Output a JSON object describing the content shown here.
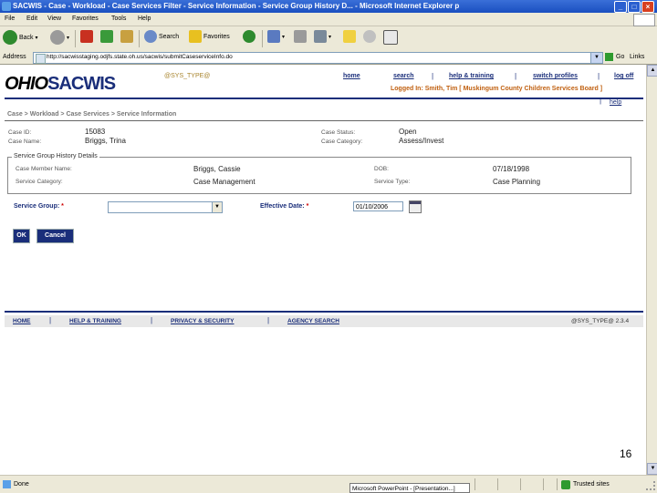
{
  "window": {
    "title": "SACWIS - Case - Workload - Case Services Filter - Service Information - Service Group History D... - Microsoft Internet Explorer p",
    "min": "_",
    "max": "□",
    "close": "×"
  },
  "menu": [
    "File",
    "Edit",
    "View",
    "Favorites",
    "Tools",
    "Help"
  ],
  "toolbar": {
    "back": "Back",
    "search": "Search",
    "favorites": "Favorites"
  },
  "address": {
    "label": "Address",
    "url": "http://sacwisstaging.odjfs.state.oh.us/sacwis/submitCaseserviceInfo.do",
    "go": "Go",
    "links": "Links"
  },
  "header": {
    "logo_ohio": "OHIO",
    "logo_sacwis": "SACWIS",
    "systype": "@SYS_TYPE@",
    "nav": [
      "home",
      "search",
      "help & training",
      "switch profiles",
      "log off"
    ],
    "logged_in": "Logged In: Smith, Tim [ Muskingum County Children Services Board ]",
    "help": "help"
  },
  "breadcrumb": "Case > Workload > Case Services > Service Information",
  "case": {
    "id_label": "Case ID:",
    "id": "15083",
    "name_label": "Case Name:",
    "name": "Briggs, Trina",
    "status_label": "Case Status:",
    "status": "Open",
    "category_label": "Case Category:",
    "category": "Assess/Invest"
  },
  "history": {
    "legend": "Service Group History Details",
    "member_label": "Case Member Name:",
    "member": "Briggs, Cassie",
    "dob_label": "DOB:",
    "dob": "07/18/1998",
    "svc_cat_label": "Service Category:",
    "svc_cat": "Case Management",
    "svc_type_label": "Service Type:",
    "svc_type": "Case Planning"
  },
  "form": {
    "group_label": "Service Group:",
    "group_value": "",
    "date_label": "Effective Date:",
    "date_value": "01/10/2006",
    "required": "*",
    "ok": "OK",
    "cancel": "Cancel"
  },
  "footer": {
    "links": [
      "HOME",
      "HELP & TRAINING",
      "PRIVACY & SECURITY",
      "AGENCY SEARCH"
    ],
    "systype": "@SYS_TYPE@ 2.3.4"
  },
  "slide_number": "16",
  "status": {
    "done": "Done",
    "taskbar": "Microsoft PowerPoint - [Presentation...]",
    "zone": "Trusted sites"
  },
  "colors": {
    "navy": "#1a2e7a",
    "orange": "#c06010",
    "gold": "#a8842c",
    "titlebar": "#1a4fc0"
  }
}
